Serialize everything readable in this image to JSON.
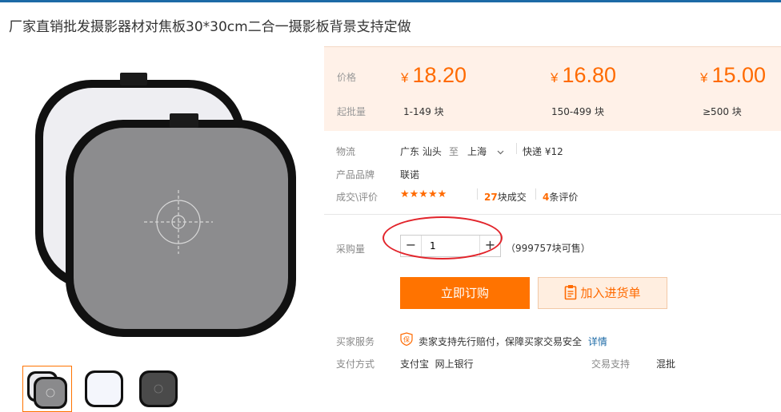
{
  "title": "厂家直销批发摄影器材对焦板30*30cm二合一摄影板背景支持定做",
  "price_panel": {
    "price_label": "价格",
    "moq_label": "起批量",
    "currency": "¥",
    "tiers": [
      {
        "price": "18.20",
        "range": "1-149 块"
      },
      {
        "price": "16.80",
        "range": "150-499 块"
      },
      {
        "price": "15.00",
        "range": "≥500 块"
      }
    ]
  },
  "logistics": {
    "label": "物流",
    "from": "广东 汕头",
    "to_word": "至",
    "to": "上海",
    "express": "快递 ¥12"
  },
  "brand": {
    "label": "产品品牌",
    "value": "联诺"
  },
  "reviews": {
    "label": "成交\\评价",
    "stars": "★★★★★",
    "deals_count": "27",
    "deals_text": "块成交",
    "review_count": "4",
    "review_text": "条评价"
  },
  "purchase": {
    "label": "采购量",
    "minus": "−",
    "plus": "+",
    "quantity": "1",
    "stock": "（999757块可售）"
  },
  "buttons": {
    "buy_now": "立即订购",
    "add_cart": "加入进货单"
  },
  "service": {
    "label": "买家服务",
    "text": "卖家支持先行赔付，保障买家交易安全",
    "link": "详情",
    "icon_char": "保"
  },
  "payment": {
    "label": "支付方式",
    "methods": "支付宝  网上银行",
    "trade_label": "交易支持",
    "trade_value": "混批"
  },
  "colors": {
    "accent": "#ff7300",
    "price": "#ff6a00",
    "link": "#1c6aa6",
    "panel_bg": "#fff1e8"
  }
}
